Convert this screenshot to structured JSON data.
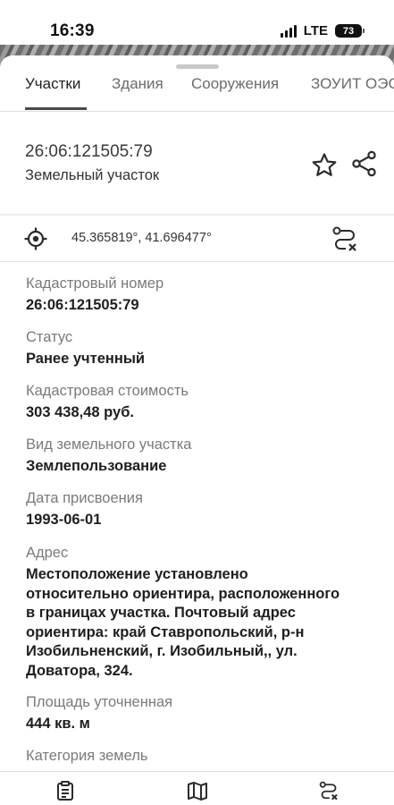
{
  "status_bar": {
    "time": "16:39",
    "network": "LTE",
    "battery": "73"
  },
  "tabs": [
    {
      "label": "Участки",
      "active": true
    },
    {
      "label": "Здания",
      "active": false
    },
    {
      "label": "Сооружения",
      "active": false
    },
    {
      "label": "ЗОУИТ ОЭС",
      "active": false
    }
  ],
  "object": {
    "cadastral_number": "26:06:121505:79",
    "type": "Земельный участок"
  },
  "location": {
    "coordinates": "45.365819°, 41.696477°"
  },
  "properties": [
    {
      "label": "Кадастровый номер",
      "value": "26:06:121505:79"
    },
    {
      "label": "Статус",
      "value": "Ранее учтенный"
    },
    {
      "label": "Кадастровая стоимость",
      "value": "303 438,48 руб."
    },
    {
      "label": "Вид земельного участка",
      "value": "Землепользование"
    },
    {
      "label": "Дата присвоения",
      "value": "1993-06-01"
    },
    {
      "label": "Адрес",
      "value_lines": [
        "Местоположение установлено",
        "относительно ориентира, расположенного",
        "в границах участка. Почтовый адрес",
        "ориентира: край Ставропольский, р-н",
        "Изобильненский, г. Изобильный,, ул.",
        "Доватора, 324."
      ]
    },
    {
      "label": "Площадь уточненная",
      "value": "444 кв. м"
    },
    {
      "label": "Категория земель",
      "value": ""
    }
  ],
  "icons": {
    "favorite": "star-icon",
    "share": "share-icon",
    "locate": "crosshair-icon",
    "route": "route-icon",
    "nav_list": "clipboard-icon",
    "nav_map": "map-icon",
    "nav_route": "route-icon"
  },
  "colors": {
    "text_primary": "#1e1e1e",
    "text_secondary": "#7a7a7a",
    "tab_underline": "#4a4a4a"
  }
}
